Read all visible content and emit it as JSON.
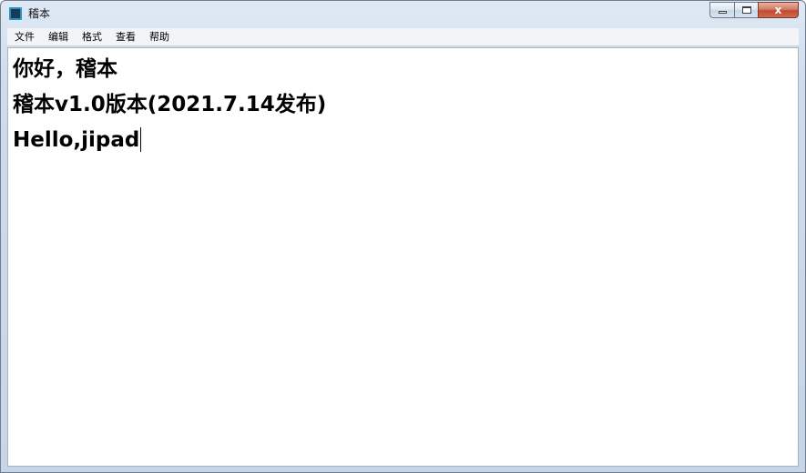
{
  "window": {
    "title": "稽本",
    "app_icon": "app-icon",
    "buttons": {
      "minimize": "minimize-icon",
      "maximize": "maximize-icon",
      "close": "x"
    }
  },
  "menu": {
    "items": [
      {
        "label": "文件"
      },
      {
        "label": "编辑"
      },
      {
        "label": "格式"
      },
      {
        "label": "查看"
      },
      {
        "label": "帮助"
      }
    ]
  },
  "editor": {
    "lines": [
      "你好，稽本",
      "稽本v1.0版本(2021.7.14发布)",
      "Hello,jipad"
    ]
  },
  "colors": {
    "titlebar": "#cfdcec",
    "menubar": "#f2f4f8",
    "editor_bg": "#ffffff",
    "close_button": "#c04b31"
  }
}
